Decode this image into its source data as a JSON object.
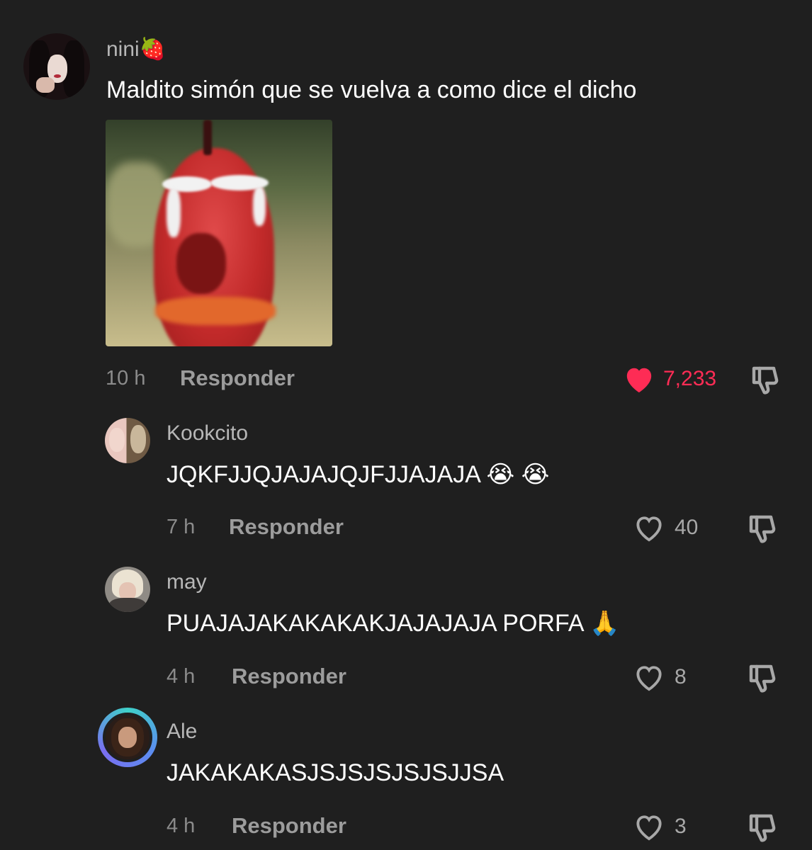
{
  "colors": {
    "background": "#1f1f1f",
    "like_active": "#fe2c55",
    "muted_text": "#9c9c9c"
  },
  "comments": [
    {
      "username": "nini🍓",
      "text": "Maldito simón que se vuelva a como dice el dicho",
      "has_sticker": true,
      "time": "10 h",
      "reply_label": "Responder",
      "likes": "7,233",
      "liked": true
    },
    {
      "username": "Kookcito",
      "text": "JQKFJJQJAJAJQJFJJAJAJA 😭 😭",
      "time": "7 h",
      "reply_label": "Responder",
      "likes": "40",
      "liked": false
    },
    {
      "username": "may",
      "text": "PUAJAJAKAKAKAKJAJAJAJA PORFA 🙏",
      "time": "4 h",
      "reply_label": "Responder",
      "likes": "8",
      "liked": false
    },
    {
      "username": "Ale",
      "text": "JAKAKAKASJSJSJSJSJSJJSA",
      "time": "4 h",
      "reply_label": "Responder",
      "likes": "3",
      "liked": false
    }
  ]
}
